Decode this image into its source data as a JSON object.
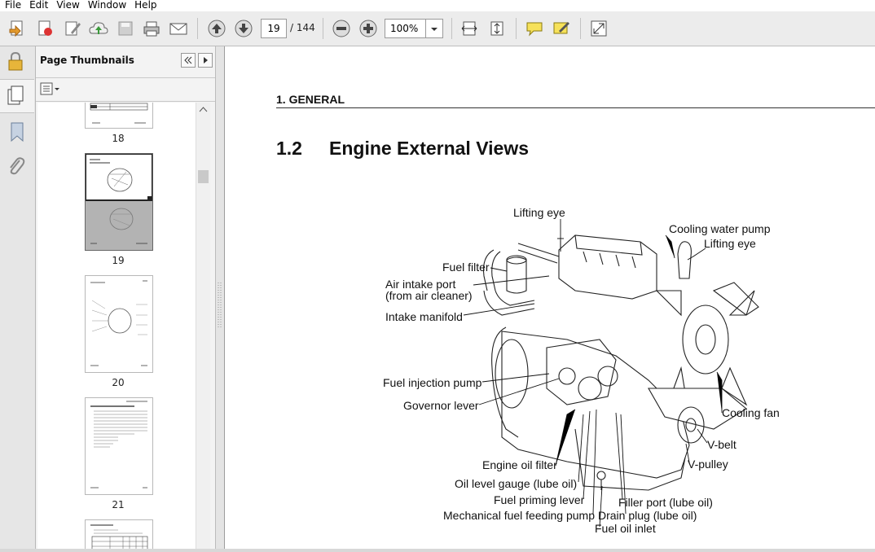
{
  "menu": [
    "File",
    "Edit",
    "View",
    "Window",
    "Help"
  ],
  "toolbar": {
    "page_current": "19",
    "page_total": "/ 144",
    "zoom": "100%"
  },
  "panel": {
    "title": "Page Thumbnails",
    "thumbnails": [
      {
        "page": "18"
      },
      {
        "page": "19"
      },
      {
        "page": "20"
      },
      {
        "page": "21"
      }
    ]
  },
  "document": {
    "section": "1. GENERAL",
    "heading_number": "1.2",
    "heading_text": "Engine External Views",
    "labels": {
      "lifting_eye_top": "Lifting eye",
      "cooling_water_pump": "Cooling water pump",
      "lifting_eye_right": "Lifting eye",
      "fuel_filter": "Fuel filter",
      "air_intake_1": "Air intake port",
      "air_intake_2": "(from air cleaner)",
      "intake_manifold": "Intake manifold",
      "fuel_injection_pump": "Fuel injection pump",
      "governor_lever": "Governor lever",
      "cooling_fan": "Cooling fan",
      "v_belt": "V-belt",
      "v_pulley": "V-pulley",
      "engine_oil_filter": "Engine oil filter",
      "oil_level_gauge": "Oil level gauge (lube oil)",
      "fuel_priming_lever": "Fuel priming lever",
      "filler_port": "Filler port (lube oil)",
      "mechanical_fuel_pump": "Mechanical fuel feeding pump",
      "drain_plug": "Drain plug  (lube oil)",
      "fuel_oil_inlet": "Fuel oil inlet"
    }
  }
}
